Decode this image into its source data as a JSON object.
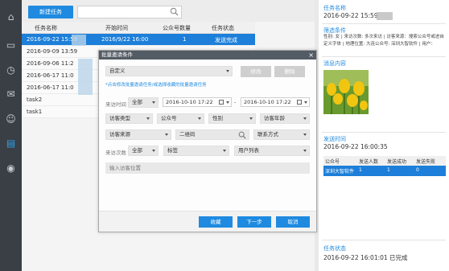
{
  "toolbar": {
    "new_task_label": "新建任务",
    "search_placeholder": ""
  },
  "grid": {
    "headers": {
      "name": "任务名称",
      "start": "开始时间",
      "count": "公众号数量",
      "status": "任务状态"
    },
    "rows": [
      {
        "name": "2016-09-22 15:59",
        "start": "2016/9/22 16:00",
        "count": "1",
        "status": "发送完成",
        "selected": true
      },
      {
        "name": "2016-09-09 13:59",
        "start": "",
        "count": "",
        "status": ""
      },
      {
        "name": "2016-09-06 11:2",
        "start": "",
        "count": "",
        "status": ""
      },
      {
        "name": "2016-06-17 11:0",
        "start": "",
        "count": "",
        "status": ""
      },
      {
        "name": "2016-06-17 11:0",
        "start": "",
        "count": "",
        "status": ""
      },
      {
        "name": "task2",
        "start": "",
        "count": "",
        "status": ""
      },
      {
        "name": "task1",
        "start": "",
        "count": "",
        "status": ""
      }
    ]
  },
  "modal": {
    "title": "批量邀请条件",
    "close": "×",
    "preset_value": "自定义",
    "modify_label": "修改",
    "delete_label": "删除",
    "hint": "*点击修改批量邀请任务/或选择收藏的批量邀请任务",
    "visit_time_label": "来访时间",
    "visit_time_range": "全部",
    "date_from": "2016-10-10 17:22",
    "date_to": "2016-10-10 17:22",
    "visitor_type": "访客类型",
    "official_account": "公众号",
    "gender": "性别",
    "visitor_age": "访客年龄",
    "visitor_source": "访客来源",
    "qr_code": "二维码",
    "contact": "联系方式",
    "visit_count_label": "来访次数",
    "visit_count_value": "全部",
    "tags": "标签",
    "user_list": "用户列表",
    "location_placeholder": "输入访客位置",
    "favorite_label": "收藏",
    "next_label": "下一步",
    "cancel_label": "取消"
  },
  "detail": {
    "task_name_label": "任务名称",
    "task_name_value": "2016-09-22 15:59",
    "filter_label": "筛选条件",
    "filter_text": "性别: 女 | 来访次数: 多次来访 | 访客来源：搜索公众号或进自定义字体 | 地理位置: 大连公众号: 深圳大智软件 | 用户：",
    "message_label": "消息内容",
    "send_time_label": "发送时间",
    "send_time_value": "2016-09-22 16:00:35",
    "table_headers": [
      "公众号",
      "发送人数",
      "发送成功",
      "发送失败"
    ],
    "table_row": [
      "深圳大智软件",
      "1",
      "1",
      "0"
    ],
    "status_label": "任务状态",
    "status_value": "2016-09-22 16:01:01 已完成"
  }
}
